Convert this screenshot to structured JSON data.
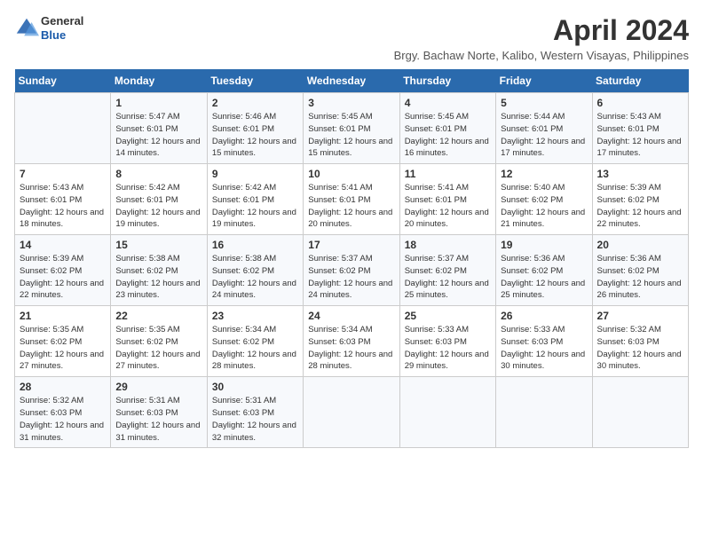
{
  "logo": {
    "general": "General",
    "blue": "Blue"
  },
  "title": "April 2024",
  "location": "Brgy. Bachaw Norte, Kalibo, Western Visayas, Philippines",
  "days_of_week": [
    "Sunday",
    "Monday",
    "Tuesday",
    "Wednesday",
    "Thursday",
    "Friday",
    "Saturday"
  ],
  "weeks": [
    [
      {
        "day": null,
        "info": null
      },
      {
        "day": "1",
        "sunrise": "Sunrise: 5:47 AM",
        "sunset": "Sunset: 6:01 PM",
        "daylight": "Daylight: 12 hours and 14 minutes."
      },
      {
        "day": "2",
        "sunrise": "Sunrise: 5:46 AM",
        "sunset": "Sunset: 6:01 PM",
        "daylight": "Daylight: 12 hours and 15 minutes."
      },
      {
        "day": "3",
        "sunrise": "Sunrise: 5:45 AM",
        "sunset": "Sunset: 6:01 PM",
        "daylight": "Daylight: 12 hours and 15 minutes."
      },
      {
        "day": "4",
        "sunrise": "Sunrise: 5:45 AM",
        "sunset": "Sunset: 6:01 PM",
        "daylight": "Daylight: 12 hours and 16 minutes."
      },
      {
        "day": "5",
        "sunrise": "Sunrise: 5:44 AM",
        "sunset": "Sunset: 6:01 PM",
        "daylight": "Daylight: 12 hours and 17 minutes."
      },
      {
        "day": "6",
        "sunrise": "Sunrise: 5:43 AM",
        "sunset": "Sunset: 6:01 PM",
        "daylight": "Daylight: 12 hours and 17 minutes."
      }
    ],
    [
      {
        "day": "7",
        "sunrise": "Sunrise: 5:43 AM",
        "sunset": "Sunset: 6:01 PM",
        "daylight": "Daylight: 12 hours and 18 minutes."
      },
      {
        "day": "8",
        "sunrise": "Sunrise: 5:42 AM",
        "sunset": "Sunset: 6:01 PM",
        "daylight": "Daylight: 12 hours and 19 minutes."
      },
      {
        "day": "9",
        "sunrise": "Sunrise: 5:42 AM",
        "sunset": "Sunset: 6:01 PM",
        "daylight": "Daylight: 12 hours and 19 minutes."
      },
      {
        "day": "10",
        "sunrise": "Sunrise: 5:41 AM",
        "sunset": "Sunset: 6:01 PM",
        "daylight": "Daylight: 12 hours and 20 minutes."
      },
      {
        "day": "11",
        "sunrise": "Sunrise: 5:41 AM",
        "sunset": "Sunset: 6:01 PM",
        "daylight": "Daylight: 12 hours and 20 minutes."
      },
      {
        "day": "12",
        "sunrise": "Sunrise: 5:40 AM",
        "sunset": "Sunset: 6:02 PM",
        "daylight": "Daylight: 12 hours and 21 minutes."
      },
      {
        "day": "13",
        "sunrise": "Sunrise: 5:39 AM",
        "sunset": "Sunset: 6:02 PM",
        "daylight": "Daylight: 12 hours and 22 minutes."
      }
    ],
    [
      {
        "day": "14",
        "sunrise": "Sunrise: 5:39 AM",
        "sunset": "Sunset: 6:02 PM",
        "daylight": "Daylight: 12 hours and 22 minutes."
      },
      {
        "day": "15",
        "sunrise": "Sunrise: 5:38 AM",
        "sunset": "Sunset: 6:02 PM",
        "daylight": "Daylight: 12 hours and 23 minutes."
      },
      {
        "day": "16",
        "sunrise": "Sunrise: 5:38 AM",
        "sunset": "Sunset: 6:02 PM",
        "daylight": "Daylight: 12 hours and 24 minutes."
      },
      {
        "day": "17",
        "sunrise": "Sunrise: 5:37 AM",
        "sunset": "Sunset: 6:02 PM",
        "daylight": "Daylight: 12 hours and 24 minutes."
      },
      {
        "day": "18",
        "sunrise": "Sunrise: 5:37 AM",
        "sunset": "Sunset: 6:02 PM",
        "daylight": "Daylight: 12 hours and 25 minutes."
      },
      {
        "day": "19",
        "sunrise": "Sunrise: 5:36 AM",
        "sunset": "Sunset: 6:02 PM",
        "daylight": "Daylight: 12 hours and 25 minutes."
      },
      {
        "day": "20",
        "sunrise": "Sunrise: 5:36 AM",
        "sunset": "Sunset: 6:02 PM",
        "daylight": "Daylight: 12 hours and 26 minutes."
      }
    ],
    [
      {
        "day": "21",
        "sunrise": "Sunrise: 5:35 AM",
        "sunset": "Sunset: 6:02 PM",
        "daylight": "Daylight: 12 hours and 27 minutes."
      },
      {
        "day": "22",
        "sunrise": "Sunrise: 5:35 AM",
        "sunset": "Sunset: 6:02 PM",
        "daylight": "Daylight: 12 hours and 27 minutes."
      },
      {
        "day": "23",
        "sunrise": "Sunrise: 5:34 AM",
        "sunset": "Sunset: 6:02 PM",
        "daylight": "Daylight: 12 hours and 28 minutes."
      },
      {
        "day": "24",
        "sunrise": "Sunrise: 5:34 AM",
        "sunset": "Sunset: 6:03 PM",
        "daylight": "Daylight: 12 hours and 28 minutes."
      },
      {
        "day": "25",
        "sunrise": "Sunrise: 5:33 AM",
        "sunset": "Sunset: 6:03 PM",
        "daylight": "Daylight: 12 hours and 29 minutes."
      },
      {
        "day": "26",
        "sunrise": "Sunrise: 5:33 AM",
        "sunset": "Sunset: 6:03 PM",
        "daylight": "Daylight: 12 hours and 30 minutes."
      },
      {
        "day": "27",
        "sunrise": "Sunrise: 5:32 AM",
        "sunset": "Sunset: 6:03 PM",
        "daylight": "Daylight: 12 hours and 30 minutes."
      }
    ],
    [
      {
        "day": "28",
        "sunrise": "Sunrise: 5:32 AM",
        "sunset": "Sunset: 6:03 PM",
        "daylight": "Daylight: 12 hours and 31 minutes."
      },
      {
        "day": "29",
        "sunrise": "Sunrise: 5:31 AM",
        "sunset": "Sunset: 6:03 PM",
        "daylight": "Daylight: 12 hours and 31 minutes."
      },
      {
        "day": "30",
        "sunrise": "Sunrise: 5:31 AM",
        "sunset": "Sunset: 6:03 PM",
        "daylight": "Daylight: 12 hours and 32 minutes."
      },
      {
        "day": null,
        "info": null
      },
      {
        "day": null,
        "info": null
      },
      {
        "day": null,
        "info": null
      },
      {
        "day": null,
        "info": null
      }
    ]
  ]
}
